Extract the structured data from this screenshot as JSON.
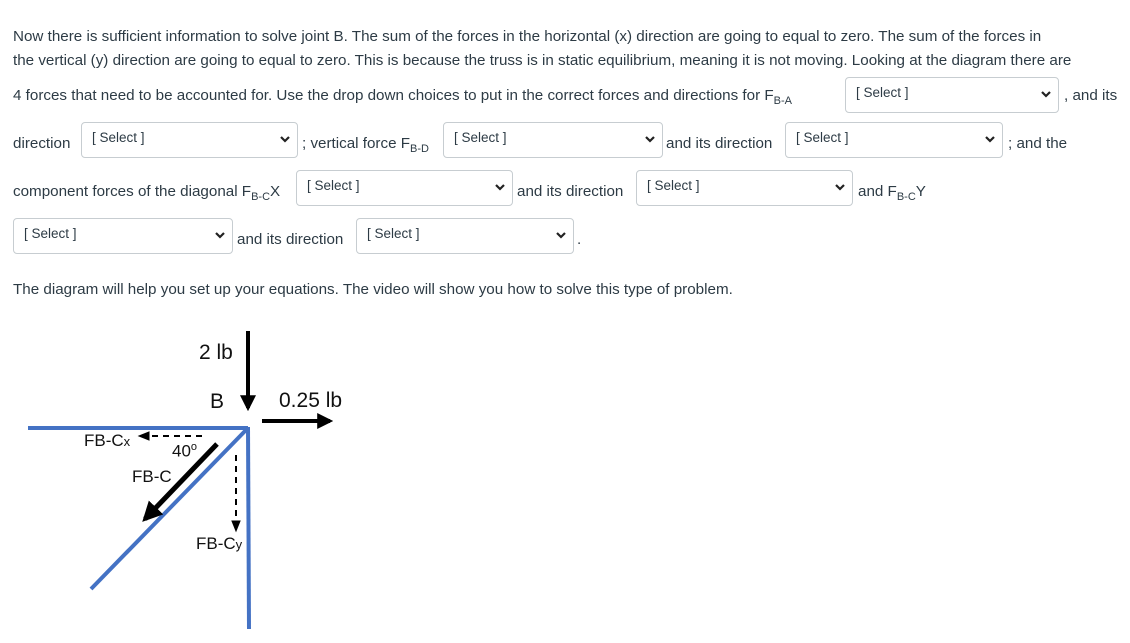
{
  "paragraph1": {
    "line1": "Now there is sufficient information to solve joint B.  The sum of the forces in the horizontal (x) direction are going to equal to zero.  The sum of the forces in",
    "line2": "the vertical (y) direction are going to equal to zero.  This is because the truss is in static equilibrium, meaning it is not moving.  Looking at the diagram there are",
    "line3_prefix": "4 forces that need to be accounted for.  Use the drop down choices to put in the correct forces and directions for F",
    "line3_sub": "B-A",
    "line3_suffix": ", and its",
    "direction_label": "direction",
    "vertical_force_prefix": "; vertical force F",
    "vertical_force_sub": "B-D",
    "and_its_direction_1": "and its direction",
    "and_the": "; and the",
    "component_prefix": "component forces of the diagonal F",
    "component_sub": "B-C",
    "component_suffix": "X",
    "and_its_direction_2": "and its direction",
    "and_fbcy_prefix": "and F",
    "and_fbcy_sub": "B-C",
    "and_fbcy_suffix": "Y",
    "and_its_direction_3": "and its direction",
    "period": "."
  },
  "selects": {
    "fba_value": "[ Select ]",
    "fba_direction": "[ Select ]",
    "fbd_value": "[ Select ]",
    "fbd_direction": "[ Select ]",
    "fbcx_value": "[ Select ]",
    "fbcx_direction": "[ Select ]",
    "fbcy_value": "[ Select ]",
    "fbcy_direction": "[ Select ]"
  },
  "paragraph2": "The diagram will help you set up your equations.  The video will show you how to solve this type of problem.",
  "diagram": {
    "load_vertical": "2 lb",
    "joint_label": "B",
    "load_horizontal": "0.25 lb",
    "fbcx_label_main": "FB-C",
    "fbcx_label_sub": "x",
    "angle_label": "40",
    "angle_unit": "o",
    "fbc_label": "FB-C",
    "fbcy_label_main": "FB-C",
    "fbcy_label_sub": "y",
    "member_color": "#4472c4",
    "arrow_color": "#000000"
  }
}
